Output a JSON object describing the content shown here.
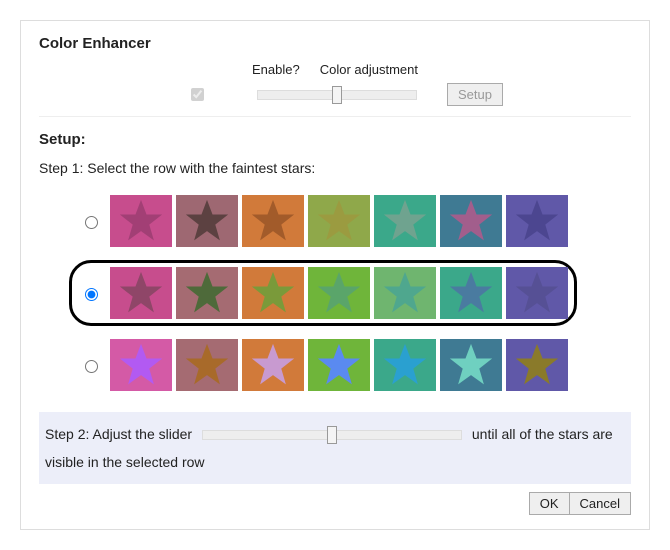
{
  "title": "Color Enhancer",
  "header": {
    "enable_label": "Enable?",
    "adjust_label": "Color adjustment",
    "enabled": true,
    "slider_value": 50,
    "setup_button": "Setup"
  },
  "setup": {
    "heading": "Setup:",
    "step1_text": "Step 1: Select the row with the faintest stars:",
    "selected_row_index": 1,
    "rows": [
      {
        "id": "row-0",
        "swatches": [
          {
            "bg": "#c74d8d",
            "star": "#a23f75"
          },
          {
            "bg": "#9e6872",
            "star": "#5c4141"
          },
          {
            "bg": "#d17a3a",
            "star": "#a25b2a"
          },
          {
            "bg": "#8fa84a",
            "star": "#9b9b40"
          },
          {
            "bg": "#3ba88a",
            "star": "#6fa38f"
          },
          {
            "bg": "#3f7a93",
            "star": "#a25e8c"
          },
          {
            "bg": "#6058a8",
            "star": "#4c4690"
          }
        ]
      },
      {
        "id": "row-1",
        "swatches": [
          {
            "bg": "#c74d8d",
            "star": "#8f4668"
          },
          {
            "bg": "#a56b72",
            "star": "#4e6a3a"
          },
          {
            "bg": "#d17a3a",
            "star": "#7a9a3a"
          },
          {
            "bg": "#6fb53a",
            "star": "#5aa56a"
          },
          {
            "bg": "#6fb56f",
            "star": "#4fa78e"
          },
          {
            "bg": "#3ba88a",
            "star": "#4a7ba0"
          },
          {
            "bg": "#6058a8",
            "star": "#565095"
          }
        ]
      },
      {
        "id": "row-2",
        "swatches": [
          {
            "bg": "#d45aa6",
            "star": "#b25af2"
          },
          {
            "bg": "#a56b72",
            "star": "#a86a2a"
          },
          {
            "bg": "#d17a3a",
            "star": "#c89ad0"
          },
          {
            "bg": "#6fb53a",
            "star": "#5a8af0"
          },
          {
            "bg": "#3ba88a",
            "star": "#2aa0d0"
          },
          {
            "bg": "#3f7a93",
            "star": "#6fd0c0"
          },
          {
            "bg": "#6058a8",
            "star": "#8a7a2a"
          }
        ]
      }
    ],
    "step2_text_a": "Step 2: Adjust the slider",
    "step2_text_b": "until all of the stars are visible in the selected row",
    "step2_slider_value": 50
  },
  "footer": {
    "ok_label": "OK",
    "cancel_label": "Cancel"
  }
}
